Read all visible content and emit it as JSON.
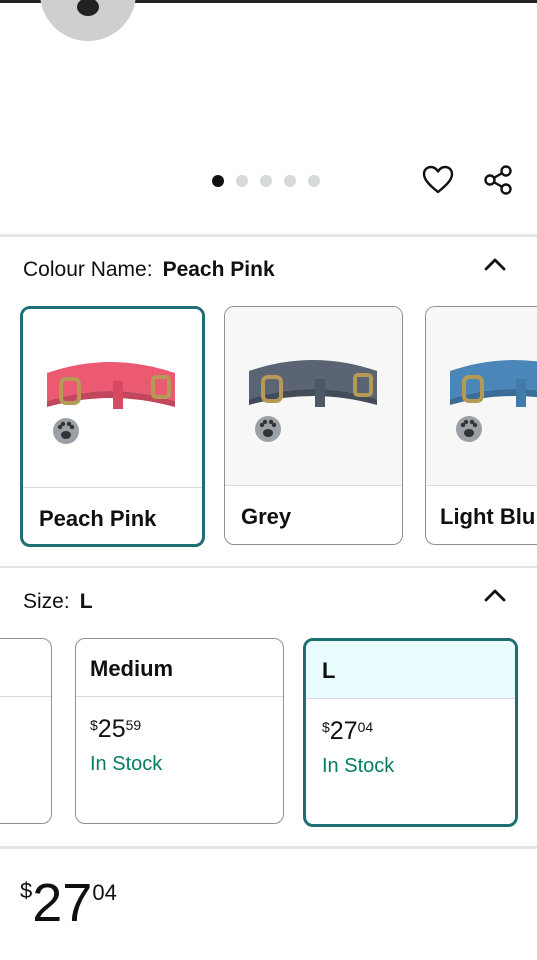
{
  "carousel": {
    "dots_count": 5,
    "active_index": 0
  },
  "actions": {
    "wishlist_icon": "heart-icon",
    "share_icon": "share-icon"
  },
  "colour": {
    "label": "Colour Name:",
    "selected": "Peach Pink",
    "options": [
      {
        "name": "Peach Pink",
        "color": "#ec5a72"
      },
      {
        "name": "Grey",
        "color": "#5b6474"
      },
      {
        "name": "Light Blu",
        "color": "#4a86b8"
      }
    ]
  },
  "size": {
    "label": "Size:",
    "selected": "L",
    "options": [
      {
        "name": "Medium",
        "price_symbol": "$",
        "price_whole": "25",
        "price_fraction": "59",
        "availability": "In Stock"
      },
      {
        "name": "L",
        "price_symbol": "$",
        "price_whole": "27",
        "price_fraction": "04",
        "availability": "In Stock"
      }
    ]
  },
  "price": {
    "symbol": "$",
    "whole": "27",
    "fraction": "04"
  },
  "colors": {
    "accent": "#1f6e73",
    "in_stock": "#067d62",
    "selected_header_bg": "#e8fbfd"
  }
}
